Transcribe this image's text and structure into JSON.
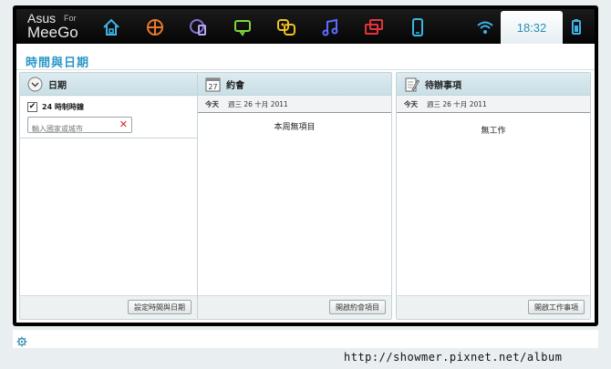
{
  "brand": {
    "line1": "Asus",
    "for": "For",
    "line2": "MeeGo"
  },
  "clock": "18:32",
  "page": {
    "title": "時間與日期"
  },
  "date_panel": {
    "title": "日期",
    "checkbox_label": "24 時制時鐘",
    "checkbox_checked": true,
    "city_placeholder": "輸入國家或城市",
    "footer_button": "設定時間與日期"
  },
  "appointments_panel": {
    "title": "約會",
    "calendar_day": "27",
    "today_label": "今天",
    "date_text": "週三 26 十月 2011",
    "empty_text": "本周無項目",
    "footer_button": "開啟約會項目"
  },
  "todo_panel": {
    "title": "待辦事項",
    "today_label": "今天",
    "date_text": "週三 26 十月 2011",
    "empty_text": "無工作",
    "footer_button": "開啟工作事項"
  },
  "watermark": "http://showmer.pixnet.net/album",
  "icons": {
    "nav": [
      "home-icon",
      "apps-grid-icon",
      "media-icon",
      "chat-icon",
      "people-icon",
      "music-icon",
      "windows-icon",
      "device-icon"
    ],
    "status": [
      "wifi-icon",
      "battery-icon",
      "settings-gear-icon"
    ]
  },
  "colors": {
    "accent": "#2a97c9",
    "clock": "#2690b5"
  }
}
